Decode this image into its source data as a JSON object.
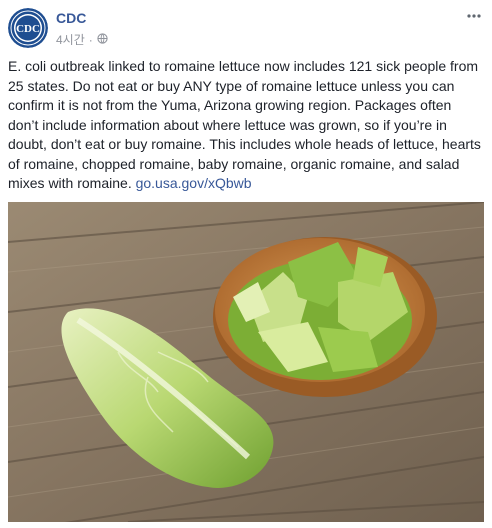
{
  "post": {
    "author": "CDC",
    "timestamp": "4시간",
    "privacy_icon": "globe-icon",
    "more_icon": "more-options-icon",
    "text": "E. coli outbreak linked to romaine lettuce now includes 121 sick people from 25 states. Do not eat or buy ANY type of romaine lettuce unless you can confirm it is not from the Yuma, Arizona growing region. Packages often don’t include information about where lettuce was grown, so if you’re in doubt, don’t eat or buy romaine. This includes whole heads of lettuce, hearts of romaine, chopped romaine, baby romaine, organic romaine, and salad mixes with romaine.",
    "link": "go.usa.gov/xQbwb"
  },
  "avatar": {
    "logo_text": "CDC",
    "color": "#1f4e91"
  },
  "colors": {
    "link": "#385898",
    "text": "#1d2129",
    "meta": "#90949c",
    "wood": "#8a7a66",
    "lettuce": "#9cc64a",
    "bowl": "#b5722f"
  }
}
